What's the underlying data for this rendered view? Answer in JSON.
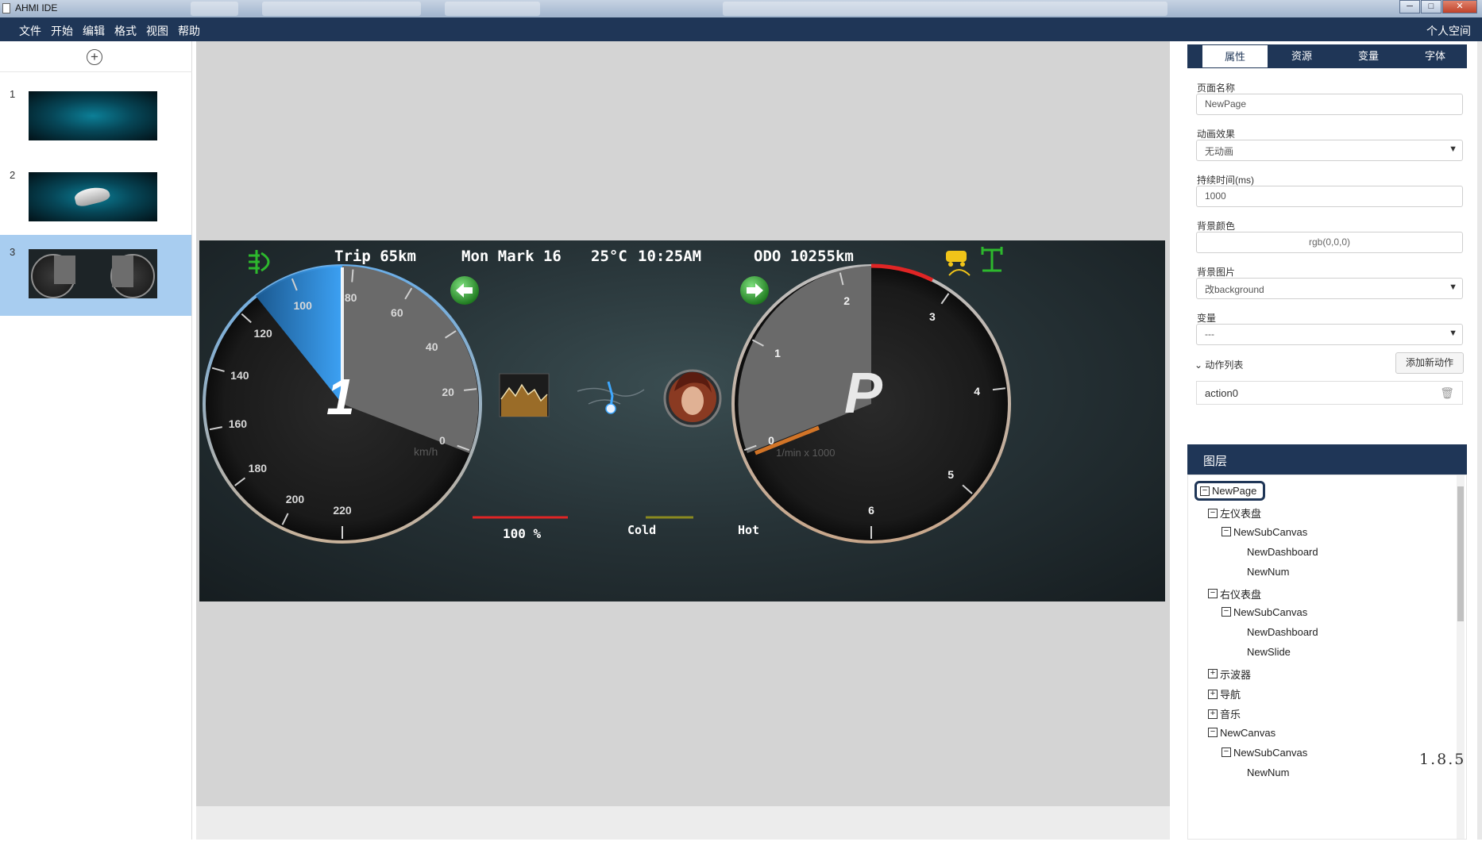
{
  "window": {
    "title": "AHMI IDE",
    "controls": [
      "─",
      "□",
      "✕"
    ]
  },
  "menu": {
    "items": [
      "文件",
      "开始",
      "编辑",
      "格式",
      "视图",
      "帮助"
    ],
    "workspace": "个人空间"
  },
  "pages": {
    "add_icon": "plus-circle-icon",
    "items": [
      {
        "number": "1",
        "thumbnail": "teal-glow"
      },
      {
        "number": "2",
        "thumbnail": "car-on-teal"
      },
      {
        "number": "3",
        "thumbnail": "dashboard",
        "selected": true
      }
    ]
  },
  "dashboard": {
    "trip": "Trip 65km",
    "date": "Mon Mark 16",
    "temperature": "25°C",
    "time": "10:25AM",
    "odo": "ODO 10255km",
    "left_gauge": {
      "value": "1",
      "unit": "km/h",
      "ticks": [
        "0",
        "20",
        "40",
        "60",
        "80",
        "100",
        "120",
        "140",
        "160",
        "180",
        "200",
        "220"
      ]
    },
    "right_gauge": {
      "gear": "P",
      "unit": "1/min x 1000",
      "ticks": [
        "0",
        "1",
        "2",
        "3",
        "4",
        "5",
        "6"
      ]
    },
    "fuel_label": "100 %",
    "temp_cold": "Cold",
    "temp_hot": "Hot",
    "icons": [
      "fog-light-icon",
      "left-arrow-icon",
      "right-arrow-icon",
      "oscilloscope-chart-icon",
      "navigation-map-icon",
      "music-avatar-icon",
      "car-warning-icon",
      "four-wheel-drive-icon"
    ],
    "colors": {
      "accent_green": "#2db82d",
      "warning_yellow": "#f0c419",
      "speed_blue": "#3ea8ff",
      "redline": "#e02525"
    }
  },
  "properties": {
    "tabs": [
      "属性",
      "资源",
      "变量",
      "字体"
    ],
    "active_tab": "属性",
    "page_name_label": "页面名称",
    "page_name_value": "NewPage",
    "animation_label": "动画效果",
    "animation_value": "无动画",
    "duration_label": "持续时间(ms)",
    "duration_value": "1000",
    "bg_color_label": "背景颜色",
    "bg_color_value": "rgb(0,0,0)",
    "bg_image_label": "背景图片",
    "bg_image_value": "改background",
    "variable_label": "变量",
    "variable_value": "---",
    "action_list_label": "动作列表",
    "add_action_label": "添加新动作",
    "action_item": "action0"
  },
  "layers": {
    "title": "图层",
    "nodes": [
      {
        "label": "NewPage",
        "level": 0,
        "toggle": "−"
      },
      {
        "label": "左仪表盘",
        "level": 1,
        "toggle": "−"
      },
      {
        "label": "NewSubCanvas",
        "level": 2,
        "toggle": "−"
      },
      {
        "label": "NewDashboard",
        "level": 3,
        "toggle": ""
      },
      {
        "label": "NewNum",
        "level": 3,
        "toggle": ""
      },
      {
        "label": "右仪表盘",
        "level": 1,
        "toggle": "−"
      },
      {
        "label": "NewSubCanvas",
        "level": 2,
        "toggle": "−"
      },
      {
        "label": "NewDashboard",
        "level": 3,
        "toggle": ""
      },
      {
        "label": "NewSlide",
        "level": 3,
        "toggle": ""
      },
      {
        "label": "示波器",
        "level": 1,
        "toggle": "+"
      },
      {
        "label": "导航",
        "level": 1,
        "toggle": "+"
      },
      {
        "label": "音乐",
        "level": 1,
        "toggle": "+"
      },
      {
        "label": "NewCanvas",
        "level": 1,
        "toggle": "−"
      },
      {
        "label": "NewSubCanvas",
        "level": 2,
        "toggle": "−"
      },
      {
        "label": "NewNum",
        "level": 3,
        "toggle": ""
      }
    ]
  },
  "version": "1.8.5"
}
